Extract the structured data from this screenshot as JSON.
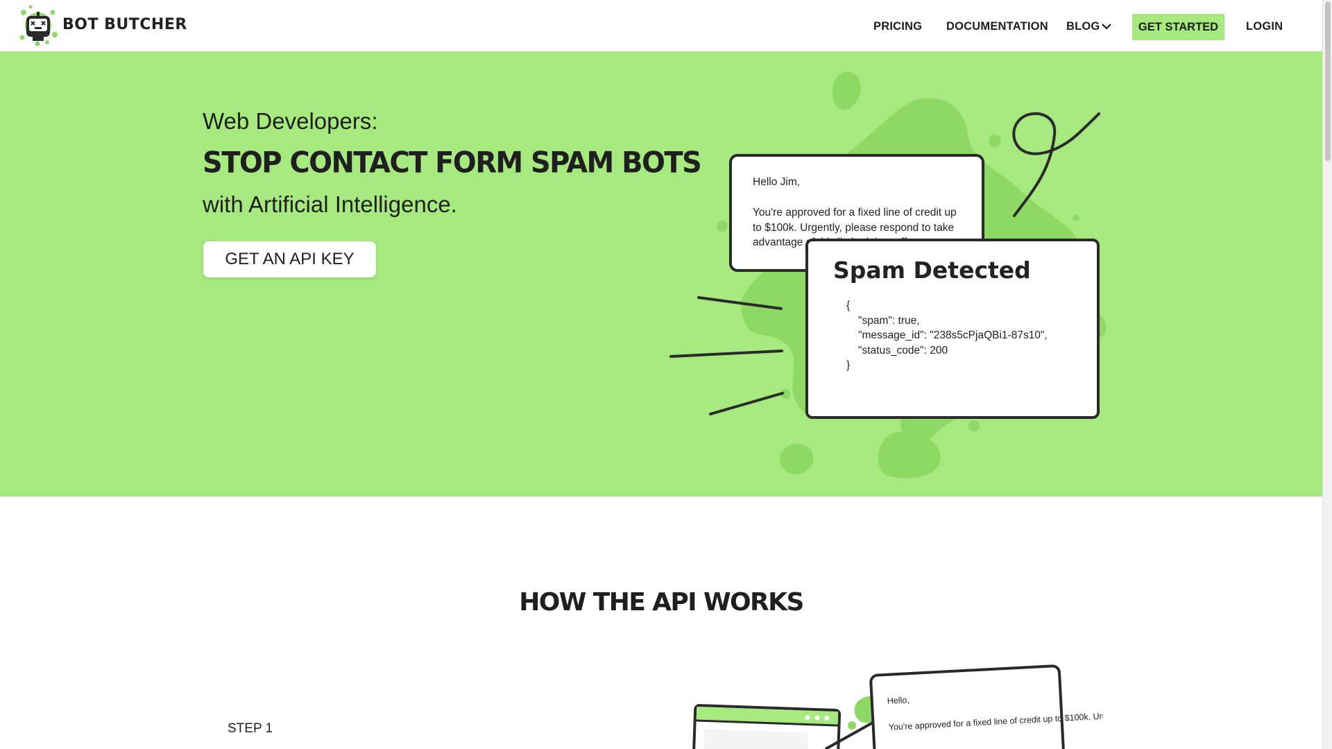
{
  "brand": {
    "name": "BOT BUTCHER"
  },
  "nav": {
    "items": [
      "PRICING",
      "DOCUMENTATION",
      "BLOG",
      "LOGIN"
    ],
    "cta": "GET STARTED"
  },
  "hero": {
    "eyebrow": "Web Developers:",
    "title": "STOP CONTACT FORM SPAM BOTS",
    "subtitle": "with Artificial Intelligence.",
    "button": "GET AN API KEY"
  },
  "email_card": {
    "greeting": "Hello Jim,",
    "body": "You're approved for a fixed line of credit up to $100k. Urgently, please respond to take advantage of this limited time offer."
  },
  "spam_card": {
    "title": "Spam Detected",
    "json_lines": [
      "{",
      "\"spam\": true,",
      "\"message_id\": \"238s5cPjaQBi1-87s10\",",
      "\"status_code\": 200",
      "}"
    ]
  },
  "how": {
    "title": "HOW THE API WORKS",
    "step": "STEP 1",
    "card_greeting": "Hello,",
    "card_text": "You're approved for a fixed line of credit up to $100k. Urgently, please respond to take advantage of this"
  },
  "colors": {
    "accent": "#a6e97e",
    "splat": "#8ed866",
    "ink": "#2a2a2a"
  },
  "icons": {
    "logo": "robot-face-icon",
    "chevron": "chevron-down-icon"
  }
}
